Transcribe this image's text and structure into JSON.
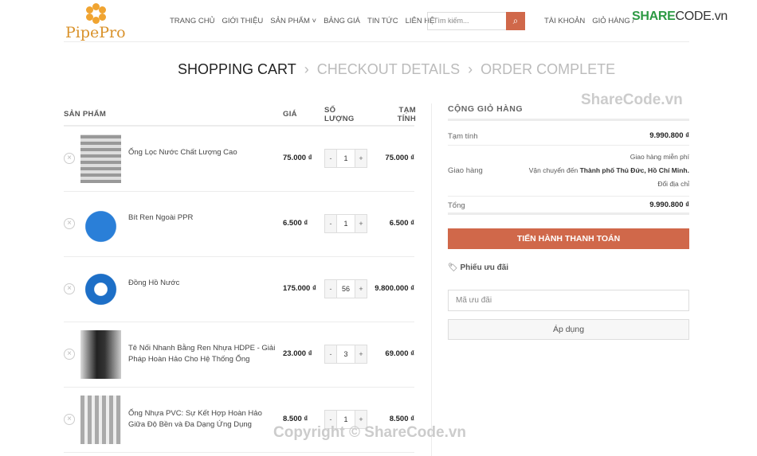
{
  "header": {
    "logo": "PipePro",
    "nav": [
      "TRANG CHỦ",
      "GIỚI THIỆU",
      "SẢN PHẨM",
      "BẢNG GIÁ",
      "TIN TỨC",
      "LIÊN HỆ"
    ],
    "search_placeholder": "Tìm kiếm...",
    "account": "TÀI KHOẢN",
    "cart": "GIỎ HÀNG /",
    "watermark_brand": "SHARE",
    "watermark_tld": "CODE.vn"
  },
  "steps": [
    "SHOPPING CART",
    "CHECKOUT DETAILS",
    "ORDER COMPLETE"
  ],
  "table": {
    "headers": {
      "product": "SẢN PHẨM",
      "price": "GIÁ",
      "qty": "SỐ LƯỢNG",
      "subtotal": "TẠM TÍNH"
    },
    "rows": [
      {
        "name": "Ống Lọc Nước Chất Lượng Cao",
        "price": "75.000 ₫",
        "qty": "1",
        "subtotal": "75.000 ₫"
      },
      {
        "name": "Bít Ren Ngoài PPR",
        "price": "6.500 ₫",
        "qty": "1",
        "subtotal": "6.500 ₫"
      },
      {
        "name": "Đồng Hồ Nước",
        "price": "175.000 ₫",
        "qty": "56",
        "subtotal": "9.800.000 ₫"
      },
      {
        "name": "Tê Nối Nhanh Bằng Ren Nhựa HDPE - Giải Pháp Hoàn Hảo Cho Hệ Thống Ống",
        "price": "23.000 ₫",
        "qty": "3",
        "subtotal": "69.000 ₫"
      },
      {
        "name": "Ống Nhựa PVC: Sự Kết Hợp Hoàn Hảo Giữa Độ Bền và Đa Dạng Ứng Dụng",
        "price": "8.500 ₫",
        "qty": "1",
        "subtotal": "8.500 ₫"
      }
    ]
  },
  "totals": {
    "title": "CỘNG GIỎ HÀNG",
    "subtotal_label": "Tạm tính",
    "subtotal": "9.990.800 ₫",
    "shipping_label": "Giao hàng",
    "shipping_free": "Giao hàng miễn phí",
    "shipping_to_prefix": "Vận chuyển đến ",
    "shipping_to": "Thành phố Thủ Đức, Hồ Chí Minh.",
    "change_address": "Đổi địa chỉ",
    "total_label": "Tổng",
    "total": "9.990.800 ₫",
    "checkout": "TIẾN HÀNH THANH TOÁN",
    "coupon_title": "Phiếu ưu đãi",
    "coupon_placeholder": "Mã ưu đãi",
    "apply": "Áp dụng"
  },
  "watermarks": [
    "ShareCode.vn",
    "Copyright © ShareCode.vn"
  ],
  "colors": {
    "accent": "#d0684a",
    "logo": "#d9922b"
  }
}
